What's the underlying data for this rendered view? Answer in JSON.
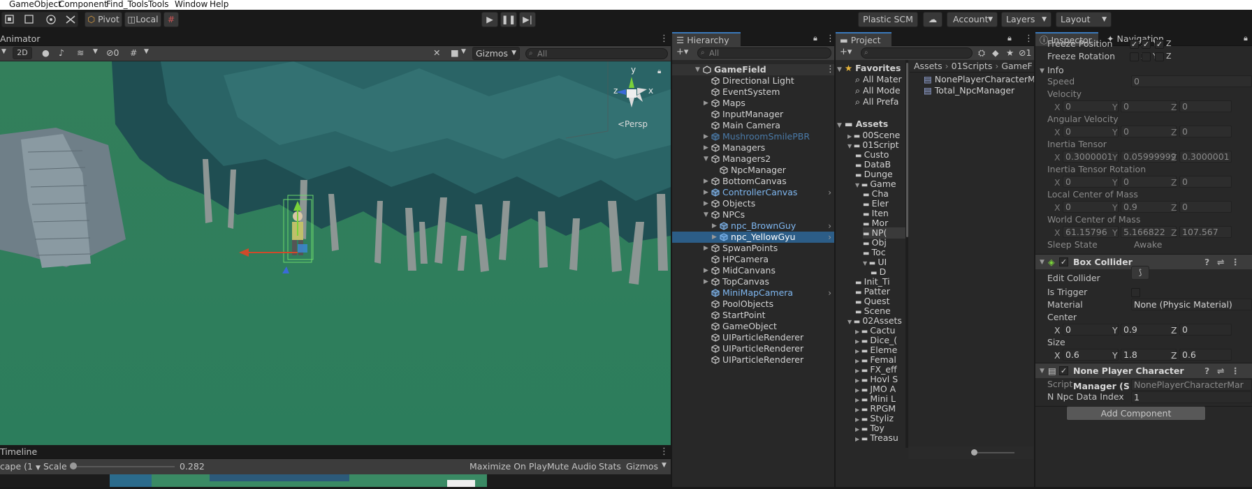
{
  "menu": [
    "GameObject",
    "Component",
    "Find_Tools",
    "Tools",
    "Window",
    "Help"
  ],
  "toolbar": {
    "pivot": "Pivot",
    "local": "Local",
    "plastic": "Plastic SCM",
    "account": "Account",
    "layers": "Layers",
    "layout": "Layout"
  },
  "scene": {
    "tab": "Animator",
    "mode_2d": "2D",
    "hidden_count": "0",
    "gizmos": "Gizmos",
    "search_placeholder": "All",
    "axis_x": "x",
    "axis_y": "y",
    "axis_z": "z",
    "persp": "<Persp"
  },
  "timeline": {
    "tab": "Timeline",
    "aspect": "cape (1",
    "scale_label": "Scale",
    "scale_value": "0.282",
    "maximize": "Maximize On Play",
    "mute": "Mute Audio",
    "stats": "Stats",
    "gizmos": "Gizmos"
  },
  "hierarchy": {
    "tab": "Hierarchy",
    "search_placeholder": "All",
    "root": "GameField",
    "items": [
      {
        "label": "Directional Light",
        "type": "go"
      },
      {
        "label": "EventSystem",
        "type": "go"
      },
      {
        "label": "Maps",
        "type": "go",
        "arrow": "right"
      },
      {
        "label": "InputManager",
        "type": "go"
      },
      {
        "label": "Main Camera",
        "type": "go"
      },
      {
        "label": "MushroomSmilePBR",
        "type": "prefab-missing",
        "arrow": "right"
      },
      {
        "label": "Managers",
        "type": "go",
        "arrow": "right"
      },
      {
        "label": "Managers2",
        "type": "go",
        "arrow": "down"
      },
      {
        "label": "NpcManager",
        "type": "go",
        "child": 1
      },
      {
        "label": "BottomCanvas",
        "type": "go",
        "arrow": "right"
      },
      {
        "label": "ControllerCanvas",
        "type": "prefab",
        "arrow": "right",
        "chev": true
      },
      {
        "label": "Objects",
        "type": "go",
        "arrow": "right"
      },
      {
        "label": "NPCs",
        "type": "go",
        "arrow": "down"
      },
      {
        "label": "npc_BrownGuy",
        "type": "prefab",
        "arrow": "right",
        "child": 1,
        "chev": true
      },
      {
        "label": "npc_YellowGyu",
        "type": "prefab",
        "arrow": "right",
        "child": 1,
        "chev": true,
        "selected": true
      },
      {
        "label": "SpwanPoints",
        "type": "go",
        "arrow": "right"
      },
      {
        "label": "HPCamera",
        "type": "go"
      },
      {
        "label": "MidCanvans",
        "type": "go",
        "arrow": "right"
      },
      {
        "label": "TopCanvas",
        "type": "go",
        "arrow": "right"
      },
      {
        "label": "MiniMapCamera",
        "type": "prefab",
        "chev": true
      },
      {
        "label": "PoolObjects",
        "type": "go"
      },
      {
        "label": "StartPoint",
        "type": "go"
      },
      {
        "label": "GameObject",
        "type": "go"
      },
      {
        "label": "UIParticleRenderer",
        "type": "go"
      },
      {
        "label": "UIParticleRenderer",
        "type": "go"
      },
      {
        "label": "UIParticleRenderer",
        "type": "go"
      }
    ]
  },
  "project": {
    "tab": "Project",
    "hidden_count": "1",
    "favorites": "Favorites",
    "fav_items": [
      "All Mater",
      "All Mode",
      "All Prefa"
    ],
    "assets": "Assets",
    "tree": [
      {
        "label": "00Scene",
        "d": 1,
        "a": "right"
      },
      {
        "label": "01Script",
        "d": 1,
        "a": "down"
      },
      {
        "label": "Custo",
        "d": 2
      },
      {
        "label": "DataB",
        "d": 2
      },
      {
        "label": "Dunge",
        "d": 2
      },
      {
        "label": "Game",
        "d": 2,
        "a": "down"
      },
      {
        "label": "Cha",
        "d": 3
      },
      {
        "label": "Eler",
        "d": 3
      },
      {
        "label": "Iten",
        "d": 3
      },
      {
        "label": "Mor",
        "d": 3
      },
      {
        "label": "NP(",
        "d": 3,
        "sel": true
      },
      {
        "label": "Obj",
        "d": 3
      },
      {
        "label": "Toc",
        "d": 3
      },
      {
        "label": "UI",
        "d": 3,
        "a": "down"
      },
      {
        "label": "D",
        "d": 4
      },
      {
        "label": "Init_Ti",
        "d": 2
      },
      {
        "label": "Patter",
        "d": 2
      },
      {
        "label": "Quest",
        "d": 2
      },
      {
        "label": "Scene",
        "d": 2
      },
      {
        "label": "02Assets",
        "d": 1,
        "a": "down"
      },
      {
        "label": "Cactu",
        "d": 2,
        "a": "right"
      },
      {
        "label": "Dice_(",
        "d": 2,
        "a": "right"
      },
      {
        "label": "Eleme",
        "d": 2,
        "a": "right"
      },
      {
        "label": "Femal",
        "d": 2,
        "a": "right"
      },
      {
        "label": "FX_eff",
        "d": 2,
        "a": "right"
      },
      {
        "label": "Hovl S",
        "d": 2,
        "a": "right"
      },
      {
        "label": "JMO A",
        "d": 2,
        "a": "right"
      },
      {
        "label": "Mini L",
        "d": 2,
        "a": "right"
      },
      {
        "label": "RPGM",
        "d": 2,
        "a": "right"
      },
      {
        "label": "Styliz",
        "d": 2,
        "a": "right"
      },
      {
        "label": "Toy",
        "d": 2,
        "a": "right"
      },
      {
        "label": "Treasu",
        "d": 2,
        "a": "right"
      }
    ],
    "breadcrumb": [
      "Assets",
      "01Scripts",
      "GameF"
    ],
    "files": [
      "NonePlayerCharacterMa",
      "Total_NpcManager"
    ]
  },
  "inspector": {
    "tab": "Inspector",
    "tab2": "Navigation",
    "freeze_position": "Freeze Position",
    "freeze_rotation": "Freeze Rotation",
    "info": "Info",
    "speed_label": "Speed",
    "speed": "0",
    "velocity_label": "Velocity",
    "velocity": [
      "0",
      "0",
      "0"
    ],
    "angvel_label": "Angular Velocity",
    "angvel": [
      "0",
      "0",
      "0"
    ],
    "inertia_label": "Inertia Tensor",
    "inertia": [
      "0.3000001",
      "0.05999999",
      "0.3000001"
    ],
    "inertia_rot_label": "Inertia Tensor Rotation",
    "inertia_rot": [
      "0",
      "0",
      "0"
    ],
    "lcom_label": "Local Center of Mass",
    "lcom": [
      "0",
      "0.9",
      "0"
    ],
    "wcom_label": "World Center of Mass",
    "wcom": [
      "61.15796",
      "5.166822",
      "107.567"
    ],
    "sleep_label": "Sleep State",
    "sleep": "Awake",
    "box_collider": "Box Collider",
    "edit_collider": "Edit Collider",
    "is_trigger": "Is Trigger",
    "material_label": "Material",
    "material": "None (Physic Material)",
    "center_label": "Center",
    "center": [
      "0",
      "0.9",
      "0"
    ],
    "size_label": "Size",
    "size": [
      "0.6",
      "1.8",
      "0.6"
    ],
    "npc_manager": "None Player Character Manager (S",
    "script_label": "Script",
    "script": "NonePlayerCharacterMar",
    "npc_index_label": "N Npc Data Index",
    "npc_index": "1",
    "add_component": "Add Component",
    "xyz": [
      "X",
      "Y",
      "Z"
    ]
  }
}
